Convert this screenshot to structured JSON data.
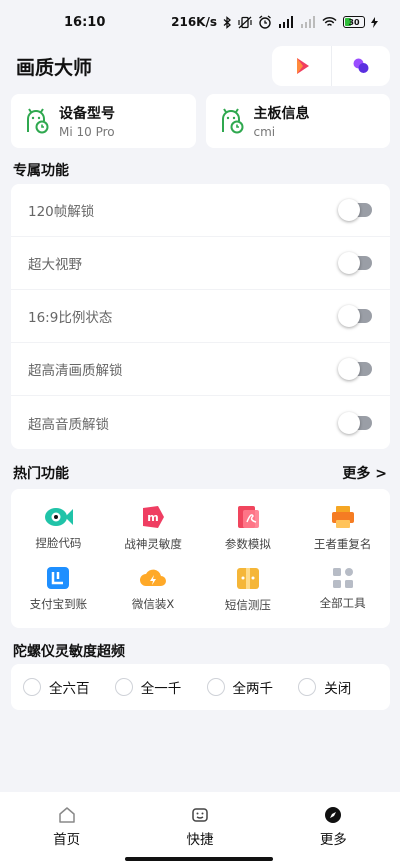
{
  "status_bar": {
    "time": "16:10",
    "network_speed": "216K/s",
    "battery": "30"
  },
  "header": {
    "title": "画质大师"
  },
  "device_cards": [
    {
      "title": "设备型号",
      "subtitle": "Mi 10 Pro"
    },
    {
      "title": "主板信息",
      "subtitle": "cmi"
    }
  ],
  "exclusive": {
    "title": "专属功能",
    "toggles": [
      {
        "label": "120帧解锁",
        "on": false
      },
      {
        "label": "超大视野",
        "on": false
      },
      {
        "label": "16:9比例状态",
        "on": false
      },
      {
        "label": "超高清画质解锁",
        "on": false
      },
      {
        "label": "超高音质解锁",
        "on": false
      }
    ]
  },
  "hot": {
    "title": "热门功能",
    "more": "更多 >",
    "tools": [
      {
        "label": "捏脸代码",
        "icon": "fish-icon",
        "color": "#20c3a8"
      },
      {
        "label": "战神灵敏度",
        "icon": "m-badge-icon",
        "color": "#ef3e62"
      },
      {
        "label": "参数模拟",
        "icon": "pdf-icon",
        "color": "#f0455d"
      },
      {
        "label": "王者重复名",
        "icon": "printer-icon",
        "color": "#f5a623"
      },
      {
        "label": "支付宝到账",
        "icon": "alipay-icon",
        "color": "#1e8fff"
      },
      {
        "label": "微信装X",
        "icon": "cloud-bolt-icon",
        "color": "#ffa928"
      },
      {
        "label": "短信测压",
        "icon": "gift-box-icon",
        "color": "#f5b638"
      },
      {
        "label": "全部工具",
        "icon": "grid-icon",
        "color": "#b7bcc6"
      }
    ]
  },
  "gyro": {
    "title": "陀螺仪灵敏度超频",
    "options": [
      "全六百",
      "全一千",
      "全两千",
      "关闭"
    ]
  },
  "nav": {
    "items": [
      "首页",
      "快捷",
      "更多"
    ]
  },
  "colors": {
    "accent_green": "#2fa84f",
    "toggle_off": "#9a9ea6",
    "background": "#f3f4f8"
  }
}
